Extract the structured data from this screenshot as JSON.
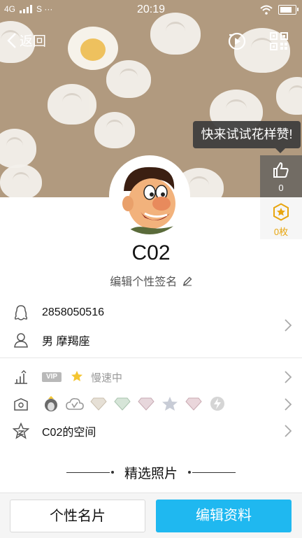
{
  "status_bar": {
    "network": "4G",
    "extra": "S ···",
    "time": "20:19"
  },
  "header": {
    "back_label": "返回",
    "music_icon": "music-icon",
    "qrcode_icon": "qrcode-icon"
  },
  "tooltip": "快来试试花样赞!",
  "like": {
    "count": "0",
    "icon": "thumb-up-icon"
  },
  "coins": {
    "count": "0枚",
    "icon": "star-coin-icon"
  },
  "profile": {
    "nickname": "C02",
    "signature_placeholder": "编辑个性签名"
  },
  "info": {
    "qq_number": "2858050516",
    "gender_sign": "男  摩羯座",
    "vip_label": "VIP",
    "speed_text": "慢速中",
    "space_text": "C02的空间"
  },
  "section": {
    "photos_title": "精选照片"
  },
  "buttons": {
    "card": "个性名片",
    "edit": "编辑资料"
  },
  "colors": {
    "accent": "#1fb8f0",
    "cover": "#b19a7f",
    "coin": "#e8a50f"
  }
}
